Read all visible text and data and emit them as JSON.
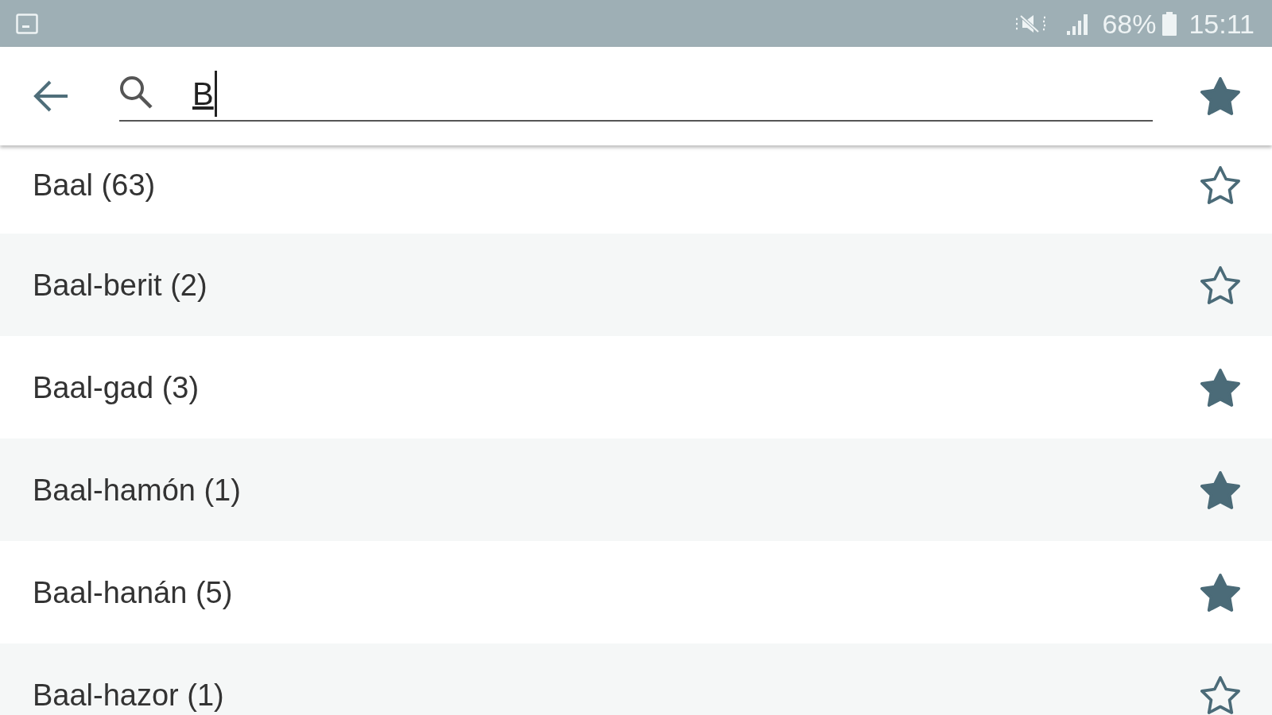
{
  "status_bar": {
    "battery": "68%",
    "time": "15:11"
  },
  "search": {
    "value": "B"
  },
  "favorites_filter": {
    "on": true
  },
  "results": [
    {
      "label": "Baal (63)",
      "favorite": false
    },
    {
      "label": "Baal-berit (2)",
      "favorite": false
    },
    {
      "label": "Baal-gad (3)",
      "favorite": true
    },
    {
      "label": "Baal-hamón (1)",
      "favorite": true
    },
    {
      "label": "Baal-hanán (5)",
      "favorite": true
    },
    {
      "label": "Baal-hazor (1)",
      "favorite": false
    }
  ]
}
